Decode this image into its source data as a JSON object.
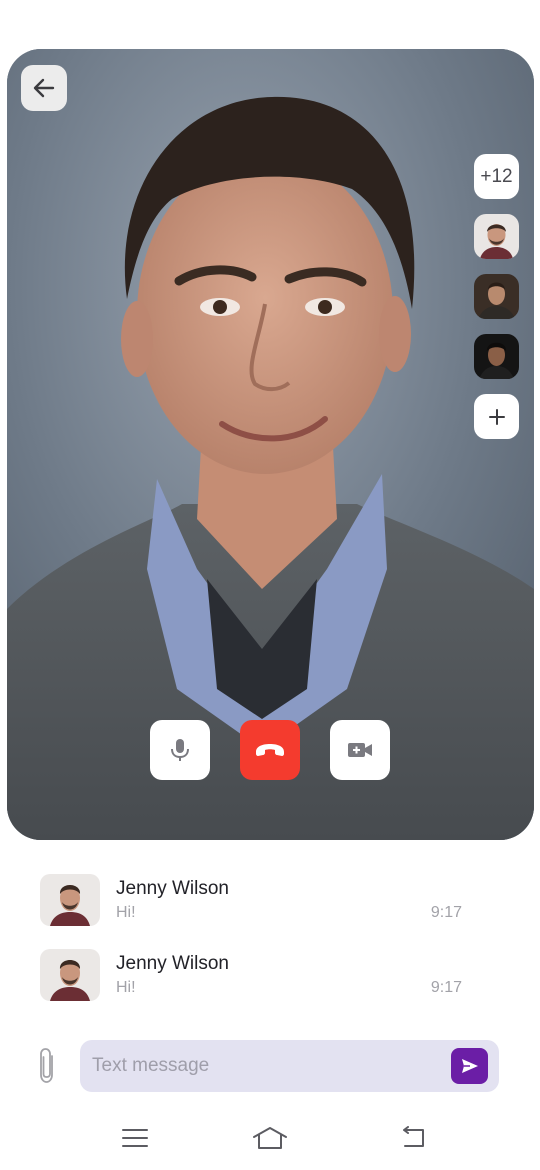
{
  "call": {
    "participants_extra": "+12",
    "icons": {
      "back": "arrow-left-icon",
      "add_participant": "plus-icon",
      "mic": "microphone-icon",
      "end_call": "phone-hangup-icon",
      "camera": "video-camera-icon"
    },
    "colors": {
      "end_call": "#f43b2e",
      "controls_bg": "#ffffff"
    }
  },
  "messages": [
    {
      "name": "Jenny Wilson",
      "text": "Hi!",
      "time": "9:17"
    },
    {
      "name": "Jenny Wilson",
      "text": "Hi!",
      "time": "9:17"
    }
  ],
  "composer": {
    "placeholder": "Text message",
    "icons": {
      "attach": "paperclip-icon",
      "send": "send-icon"
    },
    "colors": {
      "send": "#6b1ea6",
      "field_bg": "#e3e2f1"
    }
  },
  "nav": {
    "icons": [
      "menu-icon",
      "home-icon",
      "back-icon"
    ]
  }
}
